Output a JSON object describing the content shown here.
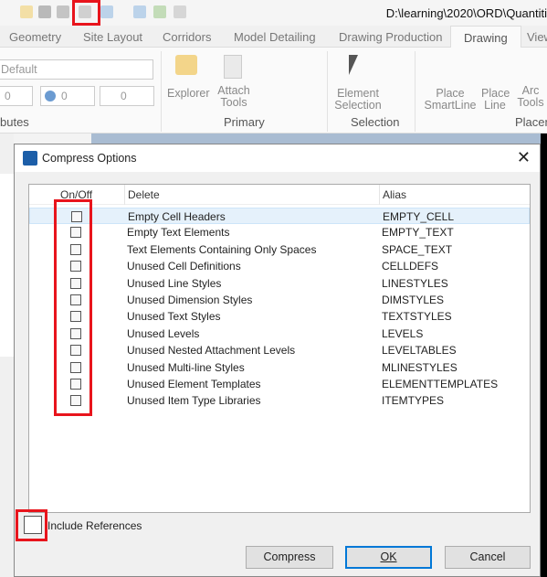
{
  "app": {
    "path": "D:\\learning\\2020\\ORD\\Quantiti",
    "tabs": [
      "Geometry",
      "Site Layout",
      "Corridors",
      "Model Detailing",
      "Drawing Production",
      "Drawing",
      "View"
    ],
    "active_tab": "Drawing",
    "ribbon": {
      "style_value": "Default",
      "attr_values": [
        "0",
        "0",
        "0"
      ],
      "buttons": [
        "Explorer",
        "Attach Tools",
        "Element Selection",
        "Place SmartLine",
        "Place Line",
        "Arc Tools"
      ],
      "groups": [
        "butes",
        "Primary",
        "Selection",
        "Placem"
      ]
    }
  },
  "dialog": {
    "title": "Compress Options",
    "columns": [
      "On/Off",
      "Delete",
      "Alias"
    ],
    "rows": [
      {
        "delete": "Empty Cell Headers",
        "alias": "EMPTY_CELL",
        "checked": false
      },
      {
        "delete": "Empty Text Elements",
        "alias": "EMPTY_TEXT",
        "checked": false
      },
      {
        "delete": "Text Elements Containing Only Spaces",
        "alias": "SPACE_TEXT",
        "checked": false
      },
      {
        "delete": "Unused Cell Definitions",
        "alias": "CELLDEFS",
        "checked": false
      },
      {
        "delete": "Unused Line Styles",
        "alias": "LINESTYLES",
        "checked": false
      },
      {
        "delete": "Unused Dimension Styles",
        "alias": "DIMSTYLES",
        "checked": false
      },
      {
        "delete": "Unused Text Styles",
        "alias": "TEXTSTYLES",
        "checked": false
      },
      {
        "delete": "Unused Levels",
        "alias": "LEVELS",
        "checked": false
      },
      {
        "delete": "Unused Nested Attachment Levels",
        "alias": "LEVELTABLES",
        "checked": false
      },
      {
        "delete": "Unused Multi-line Styles",
        "alias": "MLINESTYLES",
        "checked": false
      },
      {
        "delete": "Unused Element Templates",
        "alias": "ELEMENTTEMPLATES",
        "checked": false
      },
      {
        "delete": "Unused Item Type Libraries",
        "alias": "ITEMTYPES",
        "checked": false
      }
    ],
    "include_references": {
      "label": "Include References",
      "checked": false
    },
    "buttons": {
      "compress": "Compress",
      "ok": "OK",
      "cancel": "Cancel"
    }
  },
  "colors": {
    "highlight": "#e8141c",
    "accent": "#0078d7"
  }
}
